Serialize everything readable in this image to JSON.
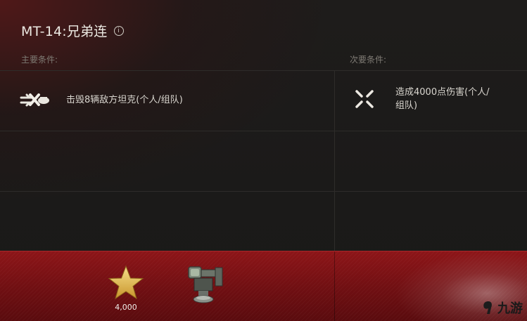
{
  "mission": {
    "title": "MT-14:兄弟连",
    "primary_label": "主要条件:",
    "secondary_label": "次要条件:",
    "primary_condition": "击毁8辆敌方坦克(个人/组队)",
    "secondary_condition_line1": "造成4000点伤害(个人/",
    "secondary_condition_line2": "组队)"
  },
  "rewards": {
    "credits_count": "4,000"
  },
  "watermark": {
    "text": "九游"
  },
  "colors": {
    "reward_band": "#7a1014",
    "star_gold": "#e2b74a"
  }
}
